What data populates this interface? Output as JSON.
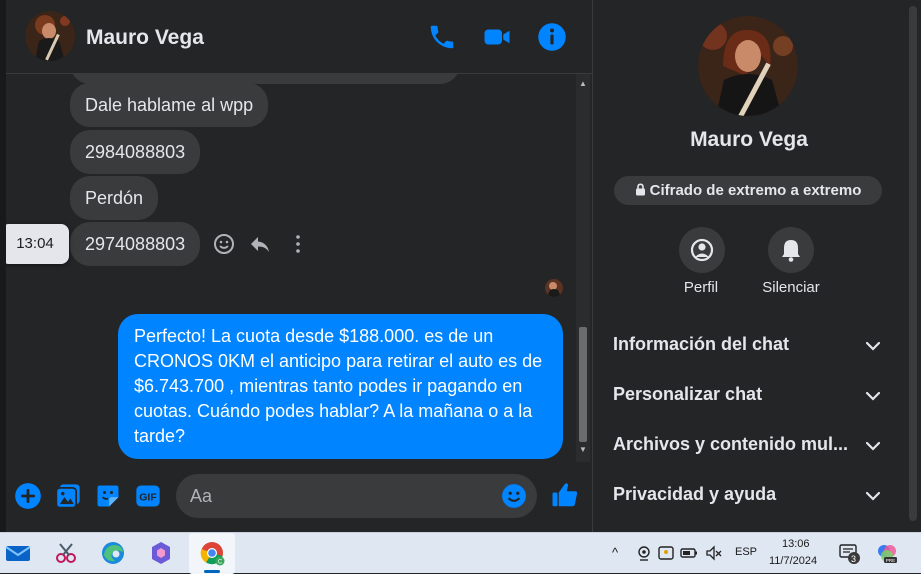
{
  "chat": {
    "contact_name": "Mauro Vega",
    "messages_in": [
      "Dale hablame al wpp",
      "2984088803",
      "Perdón",
      "2974088803"
    ],
    "hover_time": "13:04",
    "message_out": "Perfecto! La cuota desde $188.000. es de un CRONOS 0KM el anticipo para retirar el auto es de $6.743.700 , mientras tanto podes ir pagando en cuotas. Cuándo podes hablar? A la mañana o a la tarde?",
    "input_placeholder": "Aa"
  },
  "info_panel": {
    "name": "Mauro Vega",
    "encryption": "Cifrado de extremo a extremo",
    "actions": [
      "Perfil",
      "Silenciar"
    ],
    "sections": [
      "Información del chat",
      "Personalizar chat",
      "Archivos y contenido mul...",
      "Privacidad y ayuda"
    ]
  },
  "taskbar": {
    "language": "ESP",
    "time": "13:06",
    "date": "11/7/2024",
    "notification_count": "3"
  },
  "colors": {
    "accent": "#0084ff",
    "bubble_in": "#3a3b3c",
    "background": "#242526",
    "text": "#e4e6eb"
  }
}
